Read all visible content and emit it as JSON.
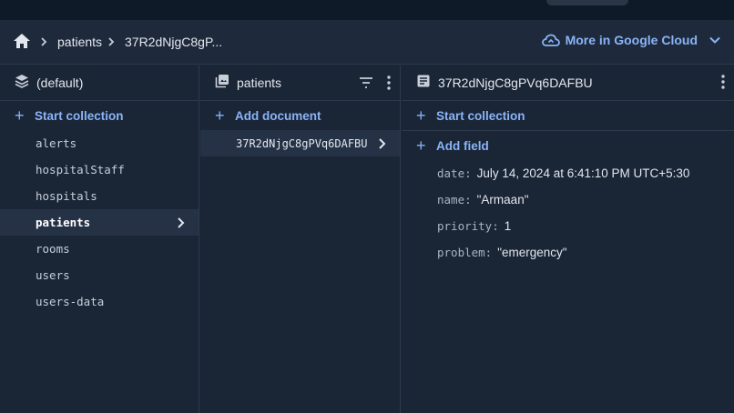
{
  "breadcrumb": {
    "items": [
      "patients",
      "37R2dNjgC8gP..."
    ]
  },
  "cloud_link": {
    "label": "More in Google Cloud"
  },
  "columns": {
    "databases": {
      "title": "(default)",
      "action": "Start collection",
      "collections": [
        "alerts",
        "hospitalStaff",
        "hospitals",
        "patients",
        "rooms",
        "users",
        "users-data"
      ],
      "selected_index": 3
    },
    "documents": {
      "title": "patients",
      "action": "Add document",
      "docs": [
        "37R2dNjgC8gPVq6DAFBU"
      ]
    },
    "fields": {
      "title": "37R2dNjgC8gPVq6DAFBU",
      "start_collection": "Start collection",
      "add_field": "Add field",
      "items": [
        {
          "key": "date:",
          "value": "July 14, 2024 at 6:41:10 PM UTC+5:30"
        },
        {
          "key": "name:",
          "value": "\"Armaan\""
        },
        {
          "key": "priority:",
          "value": "1"
        },
        {
          "key": "problem:",
          "value": "\"emergency\""
        }
      ]
    }
  },
  "colors": {
    "accent": "#8ab4f8",
    "background": "#1a2536",
    "selected": "#253246"
  }
}
